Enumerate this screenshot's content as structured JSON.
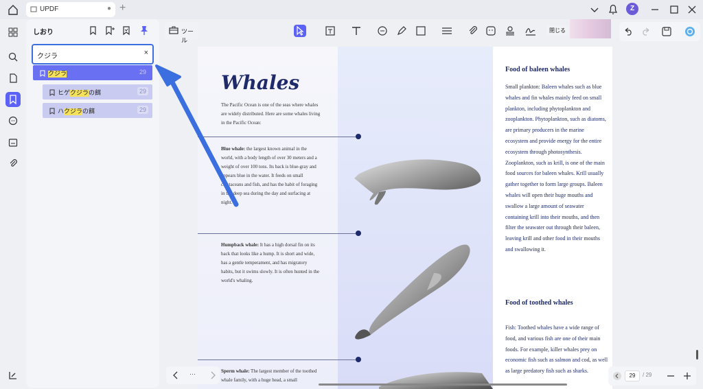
{
  "titlebar": {
    "tab_label": "UPDF",
    "avatar_letter": "Z"
  },
  "panel": {
    "title": "しおり",
    "search": {
      "value": "クジラ",
      "clear_label": "×"
    },
    "bookmarks": [
      {
        "pre": "",
        "hl": "クジラ",
        "post": "",
        "page": "29",
        "selected": true
      },
      {
        "pre": "ヒゲ",
        "hl": "クジラ",
        "post": "の餌",
        "page": "29",
        "selected": false
      },
      {
        "pre": "ハ",
        "hl": "クジラ",
        "post": "の餌",
        "page": "29",
        "selected": false
      }
    ]
  },
  "toolbar": {
    "tools_label": "ツール",
    "close_label": "閉じる"
  },
  "document": {
    "title": "Whales",
    "intro": "The Pacific Ocean is one of the seas where whales are widely distributed. Here are some whales living in the Pacific Ocean:",
    "blue_whale_label": "Blue whale:",
    "blue_whale_text": " the largest known animal in the world, with a body length of over 30 meters and a weight of over 100 tons. Its back is blue-gray and appears blue in the water. It feeds on small crustaceans and fish, and has the habit of foraging in the deep sea during the day and surfacing at night.",
    "humpback_label": "Humpback whale:",
    "humpback_text": " It has a high dorsal fin on its back that looks like a hump. It is short and wide, has a gentle temperament, and has migratory habits, but it swims slowly. It is often hunted in the world's whaling.",
    "sperm_label": "Sperm whale:",
    "sperm_text": " The largest member of the toothed whale family, with a huge head, a small",
    "baleen_heading": "Food of baleen whales",
    "baleen_text": "Small plankton: Baleen whales such as blue whales and fin whales mainly feed on small plankton, including phytoplankton and zooplankton. Phytoplankton, such as diatoms, are primary producers in the marine ecosystem and provide energy for the entire ecosystem through photosynthesis. Zooplankton, such as krill, is one of the main food sources for baleen whales. Krill usually gather together to form large groups. Baleen whales will open their huge mouths and swallow a large amount of seawater containing krill into their mouths, and then filter the seawater out through their baleen, leaving krill and other food in their mouths and swallowing it.",
    "toothed_heading": "Food of toothed whales",
    "toothed_text": "Fish: Toothed whales have a wide range of food, and various fish are one of their main foods. For example, killer whales prey on economic fish such as salmon and cod, as well as large predatory fish such as sharks."
  },
  "pager": {
    "current": "29",
    "total": "/ 29",
    "dots": "···"
  },
  "colors": {
    "accent": "#5b62f5",
    "highlight": "#f5e15a",
    "navy": "#1f2a6b",
    "arrow": "#3b6fe0"
  }
}
